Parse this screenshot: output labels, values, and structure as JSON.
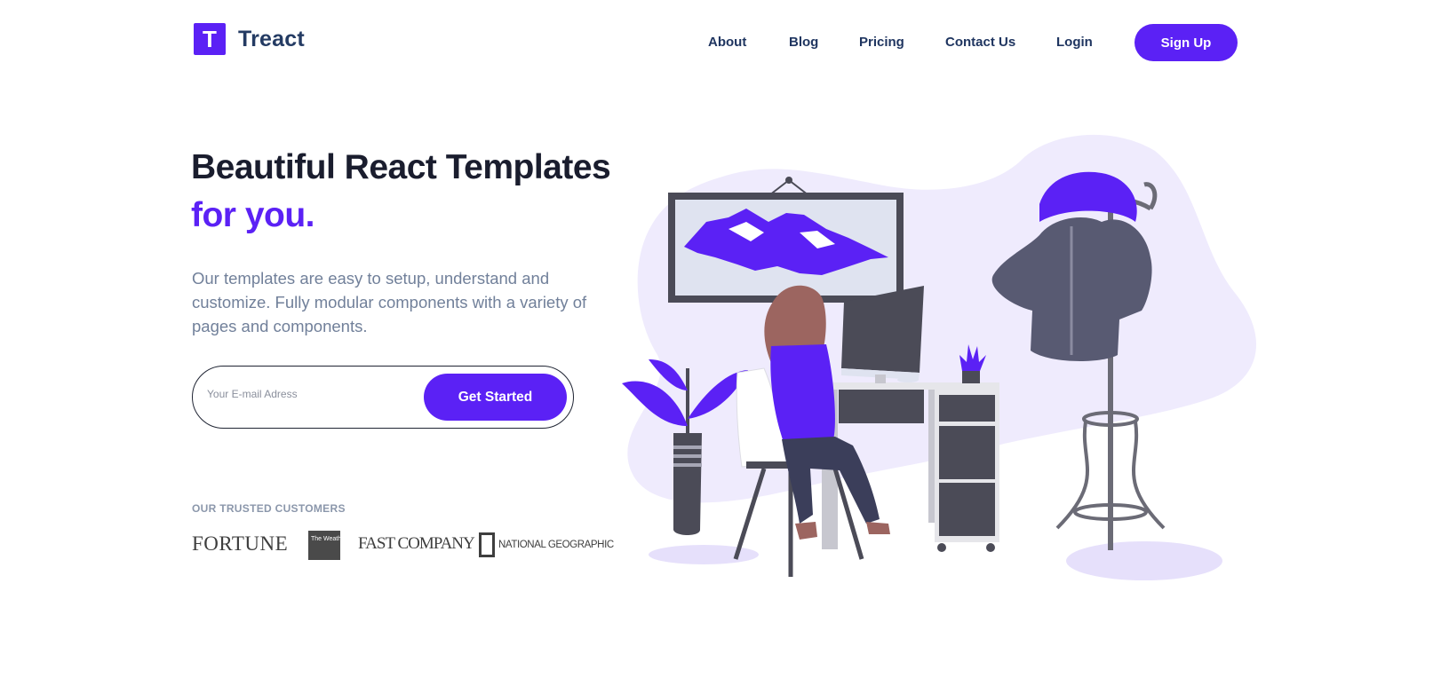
{
  "brand": {
    "name": "Treact",
    "logo_letter": "T",
    "accent_color": "#5b21f5"
  },
  "nav": {
    "items": [
      {
        "label": "About"
      },
      {
        "label": "Blog"
      },
      {
        "label": "Pricing"
      },
      {
        "label": "Contact Us"
      },
      {
        "label": "Login"
      }
    ],
    "cta_label": "Sign Up"
  },
  "hero": {
    "title_line1": "Beautiful React Templates",
    "title_line2": "for you.",
    "description": "Our templates are easy to setup, understand and customize. Fully modular components with a variety of pages and components.",
    "email_placeholder": "Your E-mail Adress",
    "cta_label": "Get Started"
  },
  "customers": {
    "label": "OUR TRUSTED CUSTOMERS",
    "logos": [
      "FORTUNE",
      "The Weather Channel",
      "FAST COMPANY",
      "NATIONAL GEOGRAPHIC"
    ]
  },
  "illustration": {
    "icon": "person-at-desk-illustration"
  }
}
